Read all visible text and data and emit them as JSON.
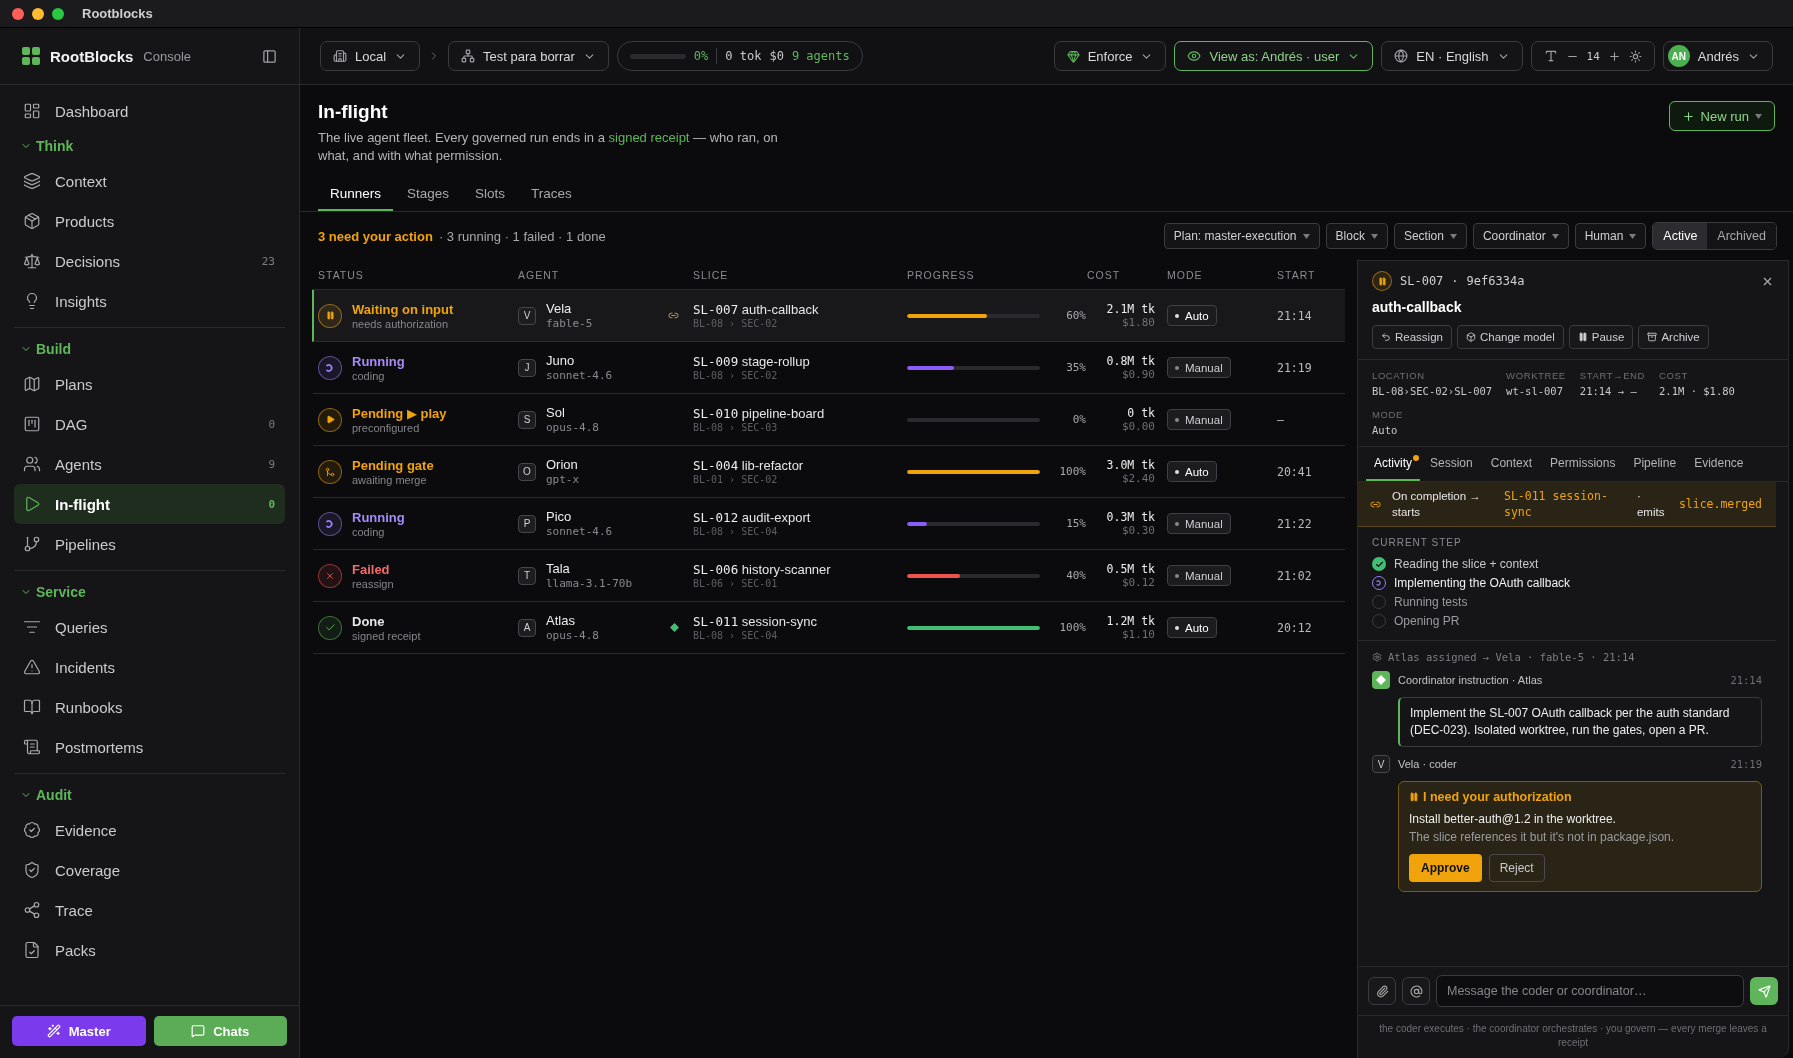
{
  "window": {
    "title": "Rootblocks"
  },
  "brand": {
    "name": "RootBlocks",
    "sub": "Console"
  },
  "topbar": {
    "workspace": "Local",
    "project": "Test para borrar",
    "usage": {
      "level": 0,
      "percent": "0%",
      "tokens": "0 tok",
      "cost": "$0",
      "agents": "9 agents"
    },
    "policy": "Enforce",
    "view_as": "View as: Andrés · user",
    "language": "EN · English",
    "font_size": "14",
    "user": {
      "initials": "AN",
      "name": "Andrés"
    }
  },
  "sidebar": {
    "top": [
      {
        "label": "Dashboard",
        "selected": false
      }
    ],
    "sections": [
      {
        "label": "Think",
        "expanded": true,
        "items": [
          {
            "label": "Context",
            "selected": false
          },
          {
            "label": "Products",
            "selected": false
          },
          {
            "label": "Decisions",
            "count": "23",
            "selected": false
          },
          {
            "label": "Insights",
            "selected": false
          }
        ]
      },
      {
        "label": "Build",
        "expanded": true,
        "items": [
          {
            "label": "Plans",
            "selected": false
          },
          {
            "label": "DAG",
            "count": "0",
            "selected": false
          },
          {
            "label": "Agents",
            "count": "9",
            "selected": false
          },
          {
            "label": "In-flight",
            "count": "0",
            "selected": true
          },
          {
            "label": "Pipelines",
            "selected": false
          }
        ]
      },
      {
        "label": "Service",
        "expanded": true,
        "items": [
          {
            "label": "Queries",
            "selected": false
          },
          {
            "label": "Incidents",
            "selected": false
          },
          {
            "label": "Runbooks",
            "selected": false
          },
          {
            "label": "Postmortems",
            "selected": false
          }
        ]
      },
      {
        "label": "Audit",
        "expanded": true,
        "items": [
          {
            "label": "Evidence",
            "selected": false
          },
          {
            "label": "Coverage",
            "selected": false
          },
          {
            "label": "Trace",
            "selected": false
          },
          {
            "label": "Packs",
            "selected": false
          }
        ]
      }
    ],
    "actions": [
      {
        "label": "Master",
        "kind": "master"
      },
      {
        "label": "Chats",
        "kind": "chats"
      }
    ]
  },
  "page": {
    "title": "In-flight",
    "description": "The live agent fleet. Every governed run ends in a",
    "link": "signed receipt",
    "description_end": "— who ran, on what, and with what permission.",
    "new_run": "New run",
    "tabs": [
      {
        "label": "Runners",
        "selected": true
      },
      {
        "label": "Stages",
        "selected": false
      },
      {
        "label": "Slots",
        "selected": false
      },
      {
        "label": "Traces",
        "selected": false
      }
    ],
    "summary": {
      "action": "3 need your action",
      "rest": "· 3 running · 1 failed · 1 done"
    },
    "filters": [
      "Plan: master-execution",
      "Block",
      "Section",
      "Coordinator",
      "Human"
    ],
    "scope": [
      {
        "label": "Active",
        "selected": true
      },
      {
        "label": "Archived",
        "selected": false
      }
    ]
  },
  "table": {
    "columns": [
      "STATUS",
      "AGENT",
      "SLICE",
      "PROGRESS",
      "COST",
      "MODE",
      "START"
    ],
    "rows": [
      {
        "kind": "waiting",
        "label": "Waiting on input",
        "sub": "needs authorization",
        "initial": "V",
        "agent": "Vela",
        "model": "fable-5",
        "linked": true,
        "signed": false,
        "slice_id": "SL-007",
        "slice": "auth-callback",
        "path": "BL-08 › SEC-02",
        "level": 0.6,
        "percent": "60%",
        "tokens": "2.1M tk",
        "cost": "$1.80",
        "mode": "Auto",
        "auto": true,
        "start": "21:14",
        "selected": true
      },
      {
        "kind": "running",
        "label": "Running",
        "sub": "coding",
        "initial": "J",
        "agent": "Juno",
        "model": "sonnet-4.6",
        "linked": false,
        "signed": false,
        "slice_id": "SL-009",
        "slice": "stage-rollup",
        "path": "BL-08 › SEC-02",
        "level": 0.35,
        "percent": "35%",
        "tokens": "0.8M tk",
        "cost": "$0.90",
        "mode": "Manual",
        "auto": false,
        "start": "21:19",
        "selected": false
      },
      {
        "kind": "pending",
        "label": "Pending ▶ play",
        "sub": "preconfigured",
        "initial": "S",
        "agent": "Sol",
        "model": "opus-4.8",
        "linked": false,
        "signed": false,
        "slice_id": "SL-010",
        "slice": "pipeline-board",
        "path": "BL-08 › SEC-03",
        "level": 0,
        "percent": "0%",
        "tokens": "0 tk",
        "cost": "$0.00",
        "mode": "Manual",
        "auto": false,
        "start": "—",
        "selected": false
      },
      {
        "kind": "gate",
        "label": "Pending gate",
        "sub": "awaiting merge",
        "initial": "O",
        "agent": "Orion",
        "model": "gpt-x",
        "linked": false,
        "signed": false,
        "slice_id": "SL-004",
        "slice": "lib-refactor",
        "path": "BL-01 › SEC-02",
        "level": 1,
        "percent": "100%",
        "tokens": "3.0M tk",
        "cost": "$2.40",
        "mode": "Auto",
        "auto": true,
        "start": "20:41",
        "selected": false
      },
      {
        "kind": "running",
        "label": "Running",
        "sub": "coding",
        "initial": "P",
        "agent": "Pico",
        "model": "sonnet-4.6",
        "linked": false,
        "signed": false,
        "slice_id": "SL-012",
        "slice": "audit-export",
        "path": "BL-08 › SEC-04",
        "level": 0.15,
        "percent": "15%",
        "tokens": "0.3M tk",
        "cost": "$0.30",
        "mode": "Manual",
        "auto": false,
        "start": "21:22",
        "selected": false
      },
      {
        "kind": "failed",
        "label": "Failed",
        "sub": "reassign",
        "initial": "T",
        "agent": "Tala",
        "model": "llama-3.1-70b",
        "linked": false,
        "signed": false,
        "slice_id": "SL-006",
        "slice": "history-scanner",
        "path": "BL-06 › SEC-01",
        "level": 0.4,
        "percent": "40%",
        "tokens": "0.5M tk",
        "cost": "$0.12",
        "mode": "Manual",
        "auto": false,
        "start": "21:02",
        "selected": false
      },
      {
        "kind": "done",
        "label": "Done",
        "sub": "signed receipt",
        "initial": "A",
        "agent": "Atlas",
        "model": "opus-4.8",
        "linked": false,
        "signed": true,
        "slice_id": "SL-011",
        "slice": "session-sync",
        "path": "BL-08 › SEC-04",
        "level": 1,
        "percent": "100%",
        "tokens": "1.2M tk",
        "cost": "$1.10",
        "mode": "Auto",
        "auto": true,
        "start": "20:12",
        "selected": false
      }
    ]
  },
  "detail": {
    "kind": "waiting",
    "slice_id": "SL-007",
    "sep": "·",
    "hash": "9ef6334a",
    "title": "auth-callback",
    "actions": [
      "Reassign",
      "Change model",
      "Pause",
      "Archive"
    ],
    "meta": [
      {
        "label": "LOCATION",
        "value": "BL-08›SEC-02›SL-007"
      },
      {
        "label": "WORKTREE",
        "value": "wt-sl-007"
      },
      {
        "label": "START→END",
        "value": "21:14 → —"
      },
      {
        "label": "COST",
        "value": "2.1M · $1.80"
      },
      {
        "label": "MODE",
        "value": "Auto"
      }
    ],
    "tabs": [
      {
        "label": "Activity",
        "selected": true,
        "unread": true
      },
      {
        "label": "Session",
        "selected": false,
        "unread": false
      },
      {
        "label": "Context",
        "selected": false,
        "unread": false
      },
      {
        "label": "Permissions",
        "selected": false,
        "unread": false
      },
      {
        "label": "Pipeline",
        "selected": false,
        "unread": false
      },
      {
        "label": "Evidence",
        "selected": false,
        "unread": false
      }
    ],
    "chain": {
      "lead": "On completion → starts",
      "target": "SL-011 session-sync",
      "sep": "·",
      "verb": "emits",
      "event": "slice.merged"
    },
    "steps_title": "CURRENT STEP",
    "steps": [
      {
        "label": "Reading the slice + context",
        "kind": "done"
      },
      {
        "label": "Implementing the OAuth callback",
        "kind": "active"
      },
      {
        "label": "Running tests",
        "kind": "todo"
      },
      {
        "label": "Opening PR",
        "kind": "todo"
      }
    ],
    "log": "Atlas assigned → Vela · fable-5 · 21:14",
    "messages": [
      {
        "kind": "instruction",
        "author": "Coordinator instruction · Atlas",
        "time": "21:14",
        "body": "Implement the SL-007 OAuth callback per the auth standard (DEC-023). Isolated worktree, run the gates, open a PR."
      },
      {
        "kind": "request",
        "initial": "V",
        "author": "Vela · coder",
        "time": "21:19",
        "title": "I need your authorization",
        "body": "Install better-auth@1.2 in the worktree.",
        "note": "The slice references it but it's not in package.json.",
        "approve": "Approve",
        "reject": "Reject"
      }
    ],
    "composer": {
      "placeholder": "Message the coder or coordinator…"
    },
    "footer": "the coder executes · the coordinator orchestrates · you govern — every merge leaves a receipt"
  }
}
